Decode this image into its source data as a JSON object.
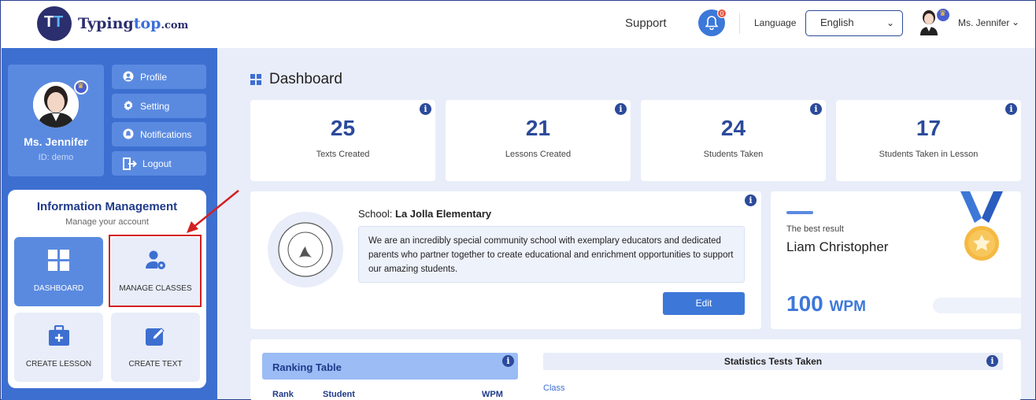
{
  "header": {
    "logo_part1": "Typing",
    "logo_part2": "top",
    "logo_part3": ".com",
    "support_label": "Support",
    "notification_count": "0",
    "language_label": "Language",
    "language_value": "English",
    "user_name": "Ms. Jennifer"
  },
  "sidebar": {
    "profile_name": "Ms. Jennifer",
    "profile_id": "ID: demo",
    "buttons": [
      {
        "label": "Profile",
        "icon": "user-circle-icon"
      },
      {
        "label": "Setting",
        "icon": "gear-icon"
      },
      {
        "label": "Notifications",
        "icon": "bell-icon"
      },
      {
        "label": "Logout",
        "icon": "logout-icon"
      }
    ],
    "panel_title": "Information Management",
    "panel_subtitle": "Manage your account",
    "tiles": [
      {
        "label": "DASHBOARD",
        "icon": "grid-icon",
        "active": true
      },
      {
        "label": "MANAGE CLASSES",
        "icon": "user-gear-icon",
        "active": false
      },
      {
        "label": "CREATE LESSON",
        "icon": "briefcase-plus-icon",
        "active": false
      },
      {
        "label": "CREATE TEXT",
        "icon": "edit-icon",
        "active": false
      }
    ]
  },
  "main": {
    "title": "Dashboard",
    "stats": [
      {
        "value": "25",
        "label": "Texts Created"
      },
      {
        "value": "21",
        "label": "Lessons Created"
      },
      {
        "value": "24",
        "label": "Students Taken"
      },
      {
        "value": "17",
        "label": "Students Taken in Lesson"
      }
    ],
    "school": {
      "label": "School:",
      "name": "La Jolla Elementary",
      "description": "We are an incredibly special community school with exemplary educators and dedicated parents who partner together to create educational and enrichment opportunities to support our amazing students.",
      "edit_label": "Edit"
    },
    "best": {
      "label": "The best result",
      "name": "Liam Christopher",
      "wpm_value": "100",
      "wpm_unit": "WPM"
    },
    "ranking": {
      "title": "Ranking Table",
      "col_rank": "Rank",
      "col_student": "Student",
      "col_wpm": "WPM"
    },
    "statistics": {
      "title": "Statistics Tests Taken",
      "class_label": "Class"
    }
  },
  "colors": {
    "primary": "#3d6fd1",
    "accent": "#3d78d8",
    "highlight": "#d32020"
  }
}
